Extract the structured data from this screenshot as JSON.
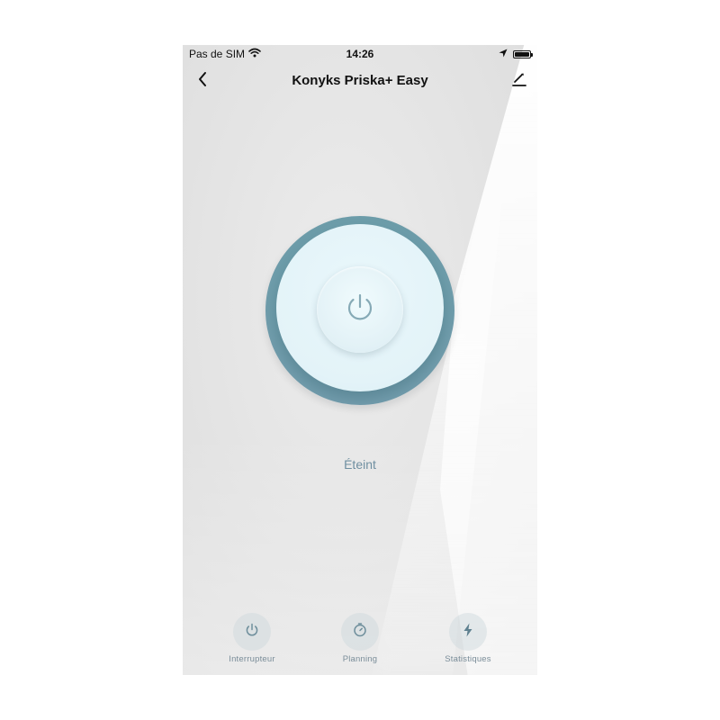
{
  "status_bar": {
    "carrier": "Pas de SIM",
    "time": "14:26",
    "battery_level": 1.0
  },
  "nav": {
    "title": "Konyks Priska+ Easy",
    "back_icon": "chevron-left-icon",
    "edit_icon": "pencil-icon"
  },
  "power": {
    "state_label": "Éteint",
    "icon": "power-icon"
  },
  "tabs": [
    {
      "label": "Interrupteur",
      "icon": "power-icon"
    },
    {
      "label": "Planning",
      "icon": "timer-icon"
    },
    {
      "label": "Statistiques",
      "icon": "lightning-icon"
    }
  ],
  "colors": {
    "accent": "#6f97a6",
    "ring": "#6d9daa",
    "label": "#6f8fa1"
  }
}
